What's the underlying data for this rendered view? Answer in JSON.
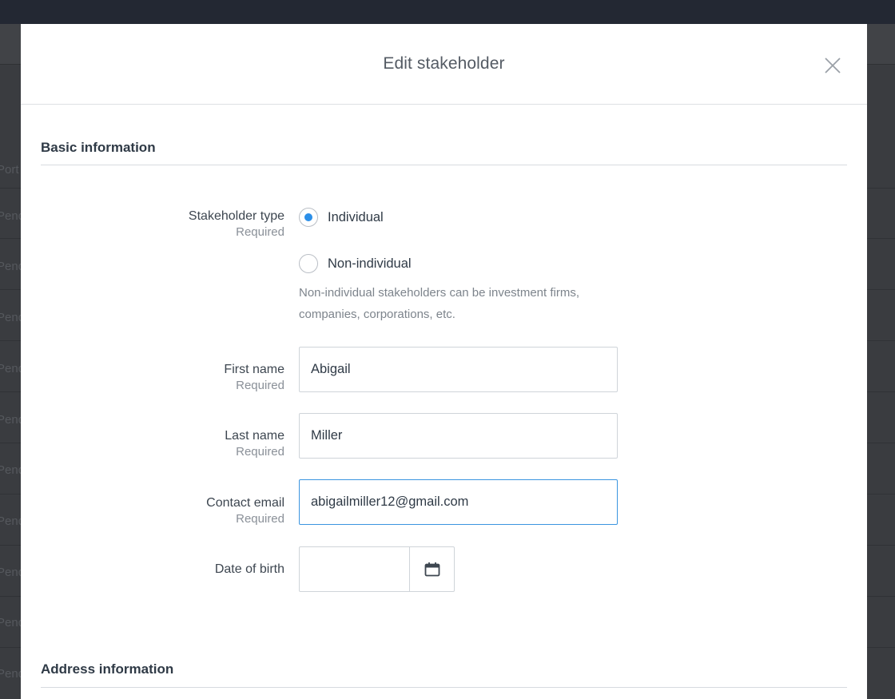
{
  "modal": {
    "title": "Edit stakeholder",
    "close_icon": "close-icon"
  },
  "background": {
    "rows": [
      "Port",
      "Pend",
      "Pend",
      "Pend",
      "Pend",
      "Pend",
      "Pend",
      "Pend",
      "Pend",
      "Pend",
      "Pend"
    ]
  },
  "basic_info": {
    "title": "Basic information",
    "stakeholder_type": {
      "label": "Stakeholder type",
      "required": "Required",
      "options": [
        "Individual",
        "Non-individual"
      ],
      "selected": "Individual",
      "help": "Non-individual stakeholders can be investment firms, companies, corporations, etc."
    },
    "first_name": {
      "label": "First name",
      "required": "Required",
      "value": "Abigail"
    },
    "last_name": {
      "label": "Last name",
      "required": "Required",
      "value": "Miller"
    },
    "contact_email": {
      "label": "Contact email",
      "required": "Required",
      "value": "abigailmiller12@gmail.com"
    },
    "date_of_birth": {
      "label": "Date of birth",
      "value": "",
      "icon": "calendar-icon"
    }
  },
  "address_info": {
    "title": "Address information"
  },
  "colors": {
    "accent": "#2c8fe8",
    "focus_border": "#3b95e0",
    "backdrop": "#3a3c40"
  }
}
